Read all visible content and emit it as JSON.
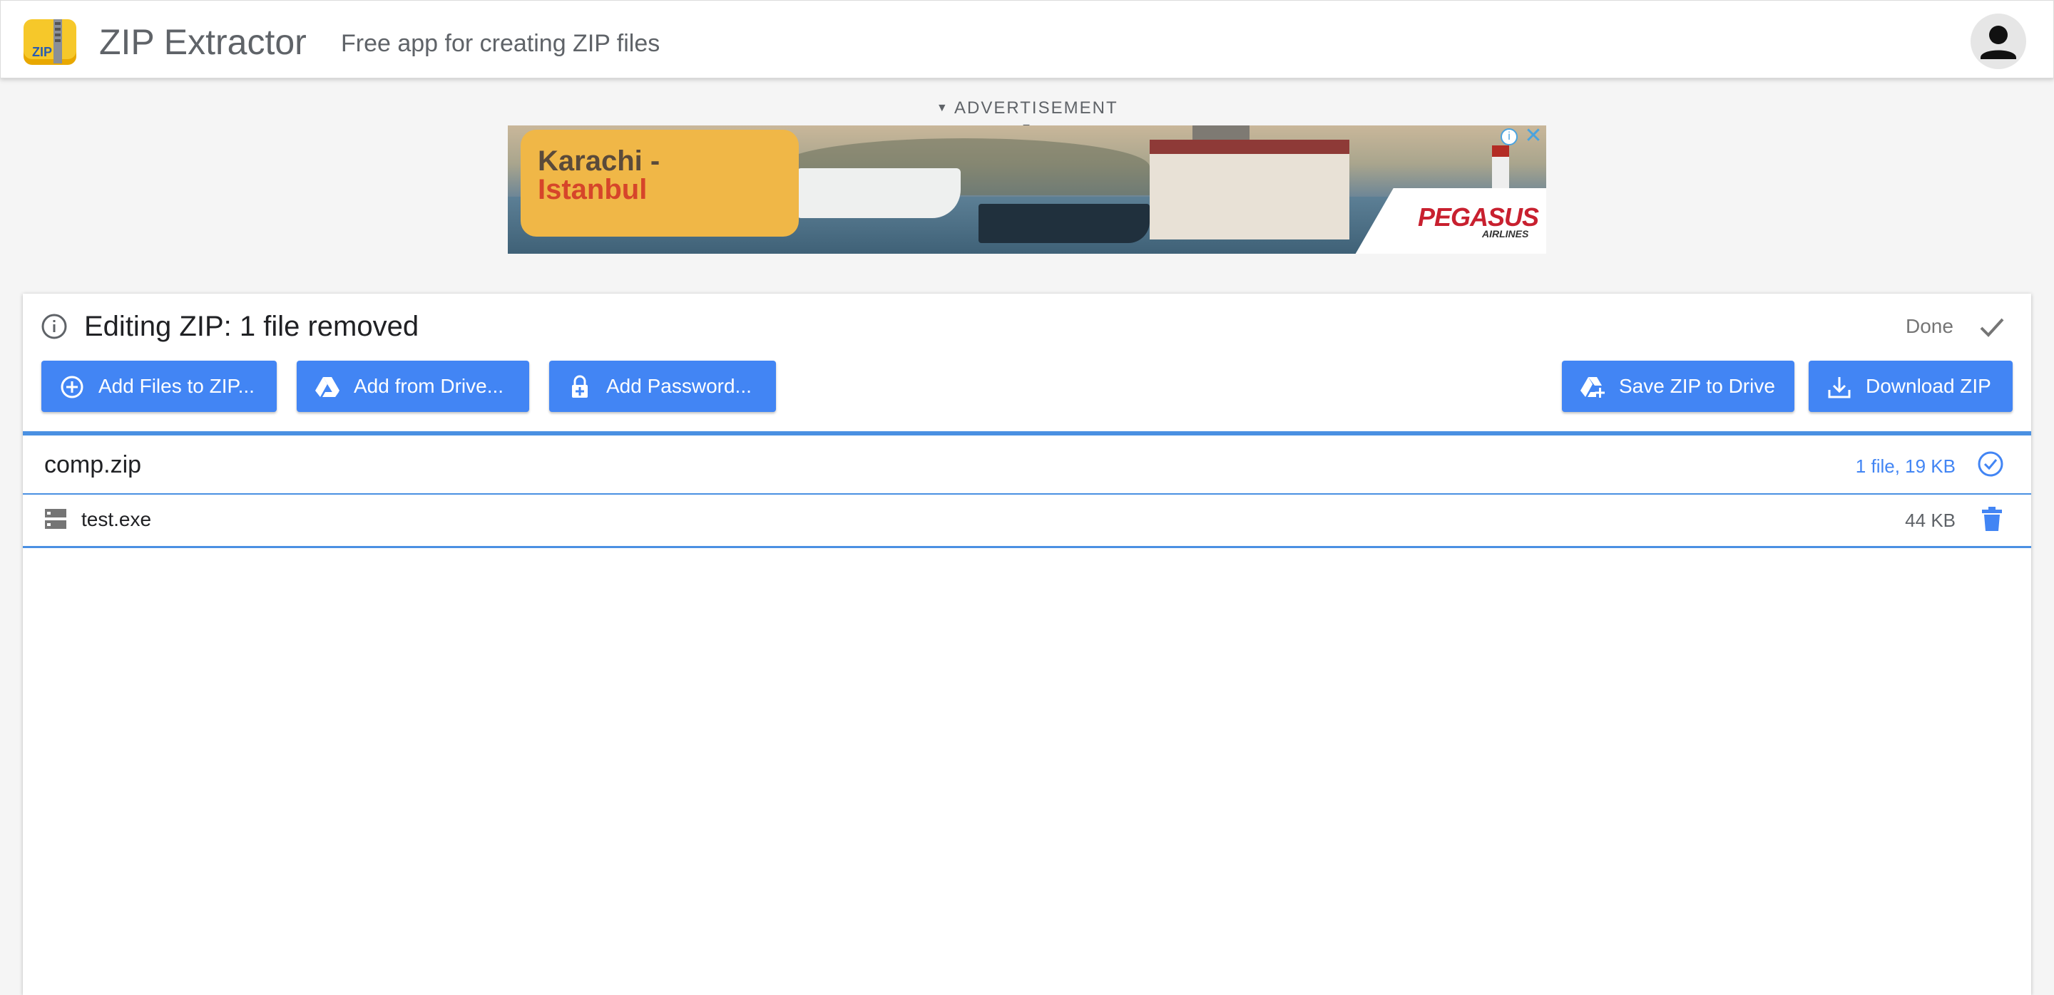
{
  "header": {
    "app_title": "ZIP Extractor",
    "app_subtitle": "Free app for creating ZIP files",
    "logo_text": "ZIP"
  },
  "ad": {
    "label": "ADVERTISEMENT",
    "headline_line1": "Karachi -",
    "headline_line2": "Istanbul",
    "brand": "PEGASUS",
    "brand_sub": "AIRLINES",
    "info_glyph": "i",
    "close_glyph": "✕"
  },
  "card": {
    "title": "Editing ZIP: 1 file removed",
    "done_label": "Done",
    "buttons": {
      "add_files": "Add Files to ZIP...",
      "add_drive": "Add from Drive...",
      "add_password": "Add Password...",
      "save_drive": "Save ZIP to Drive",
      "download": "Download ZIP"
    },
    "zip": {
      "name": "comp.zip",
      "summary": "1 file, 19 KB"
    },
    "files": [
      {
        "name": "test.exe",
        "size": "44 KB"
      }
    ]
  },
  "colors": {
    "accent": "#4285f4",
    "rule": "#4a90e2",
    "background": "#f5f5f5"
  },
  "icons": [
    "zip-logo-icon",
    "account-icon",
    "info-icon",
    "check-icon",
    "add-circle-icon",
    "drive-icon",
    "lock-icon",
    "drive-add-icon",
    "download-icon",
    "check-circle-icon",
    "file-icon",
    "trash-icon"
  ]
}
